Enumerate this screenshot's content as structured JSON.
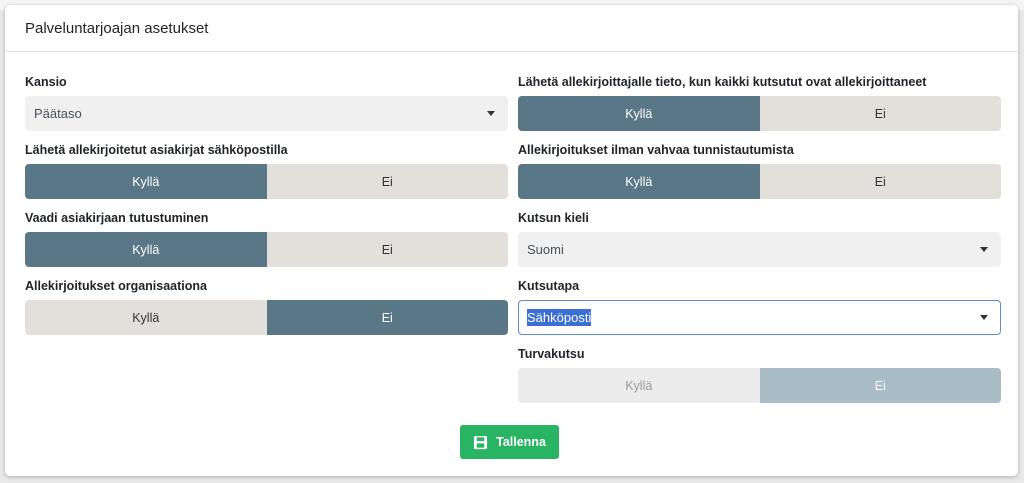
{
  "modal": {
    "title": "Palveluntarjoajan asetukset"
  },
  "left": {
    "folder": {
      "label": "Kansio",
      "value": "Päätaso"
    },
    "send_signed": {
      "label": "Lähetä allekirjoitetut asiakirjat sähköpostilla",
      "yes": "Kyllä",
      "no": "Ei",
      "selected": "yes"
    },
    "require_review": {
      "label": "Vaadi asiakirjaan tutustuminen",
      "yes": "Kyllä",
      "no": "Ei",
      "selected": "yes"
    },
    "org_signatures": {
      "label": "Allekirjoitukset organisaationa",
      "yes": "Kyllä",
      "no": "Ei",
      "selected": "no"
    }
  },
  "right": {
    "notify_all_signed": {
      "label": "Lähetä allekirjoittajalle tieto, kun kaikki kutsutut ovat allekirjoittaneet",
      "yes": "Kyllä",
      "no": "Ei",
      "selected": "yes"
    },
    "weak_auth": {
      "label": "Allekirjoitukset ilman vahvaa tunnistautumista",
      "yes": "Kyllä",
      "no": "Ei",
      "selected": "yes"
    },
    "invite_language": {
      "label": "Kutsun kieli",
      "value": "Suomi"
    },
    "invite_method": {
      "label": "Kutsutapa",
      "value": "Sähköposti"
    },
    "secure_invite": {
      "label": "Turvakutsu",
      "yes": "Kyllä",
      "no": "Ei",
      "selected": "no",
      "disabled": true
    }
  },
  "save_button": {
    "label": "Tallenna",
    "icon": "floppy-disk-icon",
    "color": "#28b463"
  },
  "colors": {
    "active_toggle": "#597786",
    "inactive_toggle": "#e3dfdb",
    "disabled_active": "#aabcc5"
  }
}
